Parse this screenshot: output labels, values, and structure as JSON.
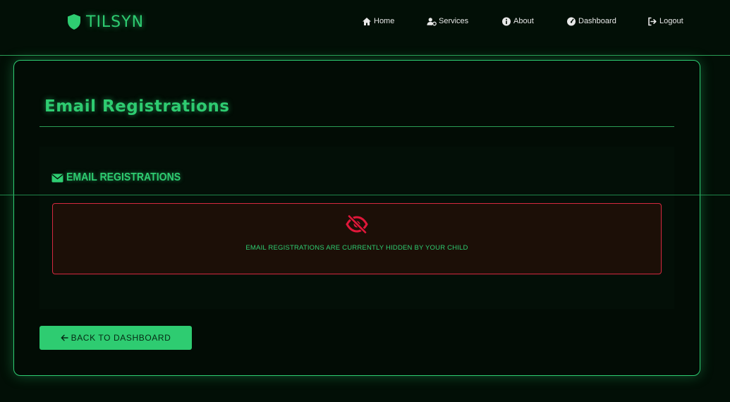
{
  "navbar": {
    "brand": "TILSYN",
    "items": [
      {
        "label": "Home",
        "icon": "home-icon"
      },
      {
        "label": "Services",
        "icon": "user-gear-icon"
      },
      {
        "label": "About",
        "icon": "info-icon"
      },
      {
        "label": "Dashboard",
        "icon": "gauge-icon"
      },
      {
        "label": "Logout",
        "icon": "logout-icon"
      }
    ]
  },
  "main": {
    "title": "Email Registrations",
    "panel": {
      "title": "EMAIL REGISTRATIONS",
      "icon": "envelope-icon",
      "alert": {
        "icon": "eye-slash-icon",
        "message": "EMAIL REGISTRATIONS ARE CURRENTLY HIDDEN BY YOUR CHILD"
      }
    },
    "back_button": "BACK TO DASHBOARD"
  },
  "colors": {
    "accent": "#2ecc71",
    "background": "#020f06",
    "alert_border": "#d6283f",
    "alert_icon": "#e0173a"
  }
}
